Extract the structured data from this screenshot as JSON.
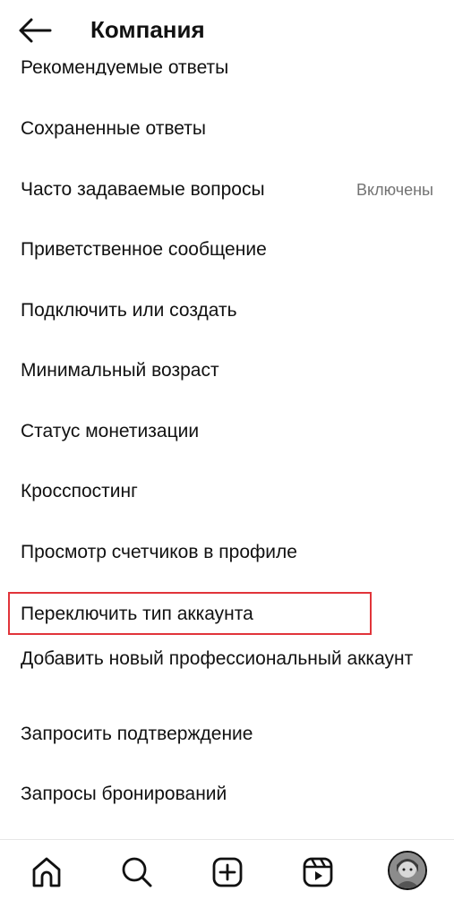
{
  "header": {
    "back_icon": "arrow-left-icon",
    "title": "Компания"
  },
  "menu": {
    "items": [
      {
        "label": "Рекомендуемые ответы"
      },
      {
        "label": "Сохраненные ответы"
      },
      {
        "label": "Часто задаваемые вопросы",
        "value": "Включены"
      },
      {
        "label": "Приветственное сообщение"
      },
      {
        "label": "Подключить или создать"
      },
      {
        "label": "Минимальный возраст"
      },
      {
        "label": "Статус монетизации"
      },
      {
        "label": "Кросспостинг"
      },
      {
        "label": "Просмотр счетчиков в профиле"
      },
      {
        "label": "Переключить тип аккаунта",
        "highlighted": true
      },
      {
        "label": "Добавить новый профессиональный аккаунт"
      },
      {
        "label": "Запросить подтверждение"
      },
      {
        "label": "Запросы бронирований"
      }
    ]
  },
  "bottom_nav": {
    "icons": [
      "home-icon",
      "search-icon",
      "create-plus-icon",
      "reels-icon",
      "profile-avatar"
    ]
  },
  "colors": {
    "highlight_border": "#e1343a",
    "secondary_text": "#737373",
    "primary_text": "#111111"
  }
}
